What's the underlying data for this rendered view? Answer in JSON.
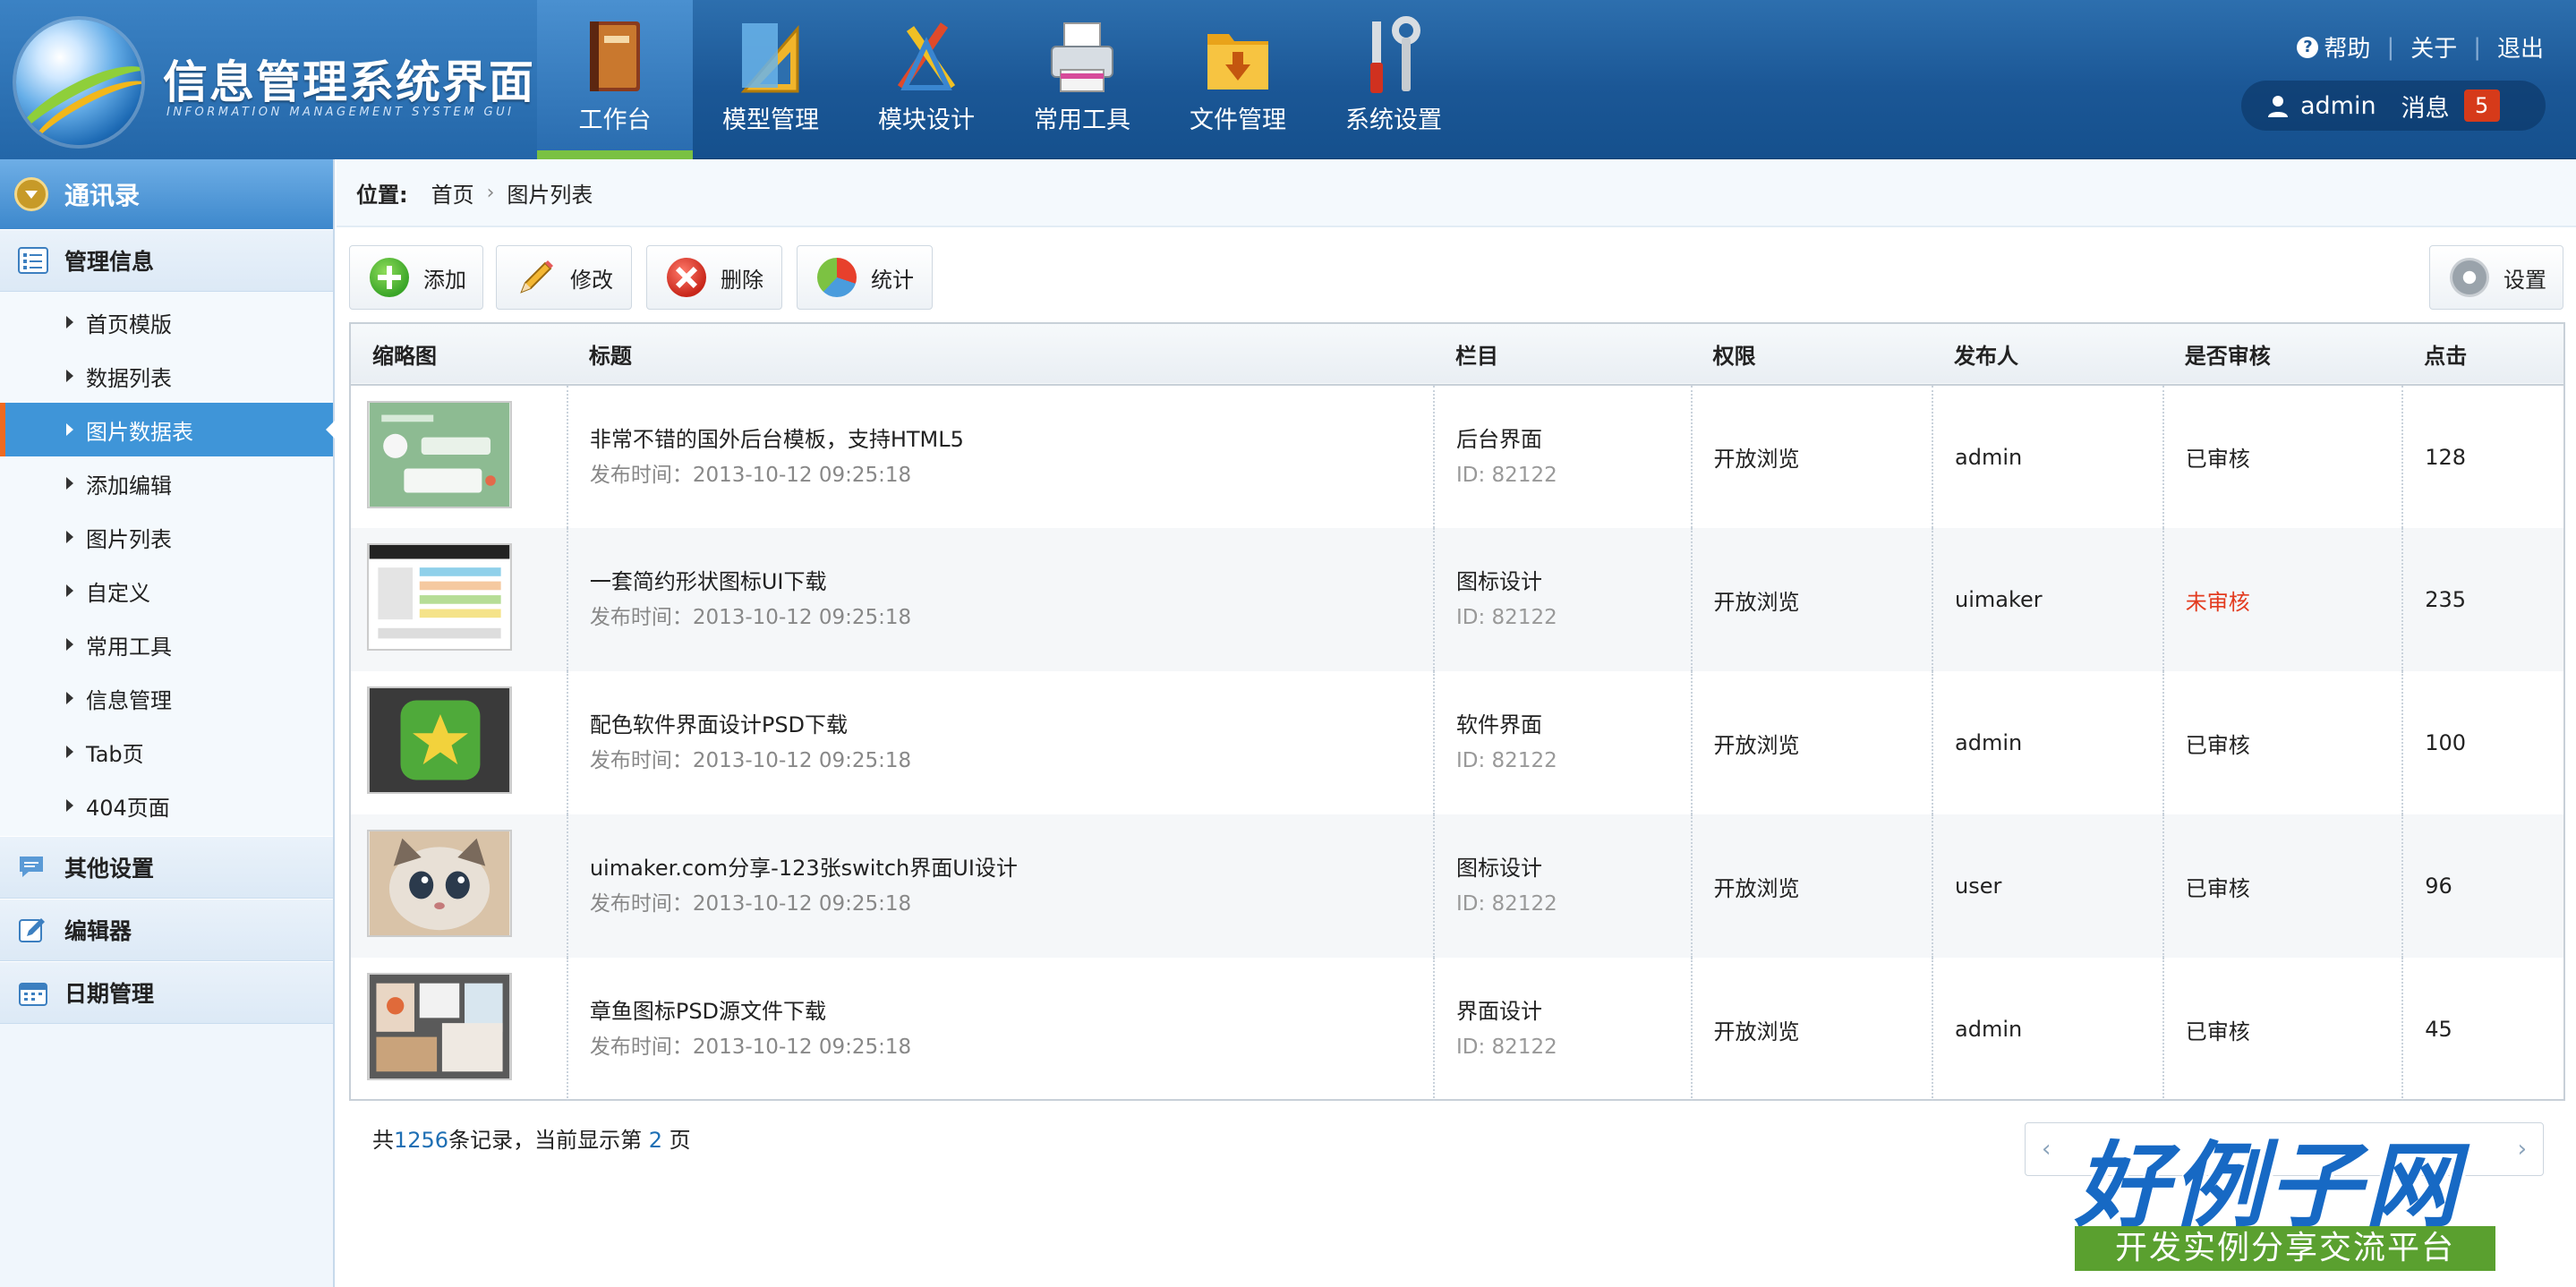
{
  "header": {
    "logo_title": "信息管理系统界面",
    "logo_subtitle": "INFORMATION MANAGEMENT SYSTEM GUI",
    "nav": [
      {
        "label": "工作台",
        "icon": "book-icon"
      },
      {
        "label": "模型管理",
        "icon": "ruler-triangle-icon"
      },
      {
        "label": "模块设计",
        "icon": "design-tools-icon"
      },
      {
        "label": "常用工具",
        "icon": "printer-icon"
      },
      {
        "label": "文件管理",
        "icon": "folder-icon"
      },
      {
        "label": "系统设置",
        "icon": "wrench-icon"
      }
    ],
    "links": {
      "help": "帮助",
      "about": "关于",
      "logout": "退出"
    },
    "user": "admin",
    "messages_label": "消息",
    "messages_count": "5"
  },
  "sidebar": {
    "top": "通讯录",
    "section_manage": "管理信息",
    "items": [
      "首页模版",
      "数据列表",
      "图片数据表",
      "添加编辑",
      "图片列表",
      "自定义",
      "常用工具",
      "信息管理",
      "Tab页",
      "404页面"
    ],
    "active_item": "图片数据表",
    "section_other": "其他设置",
    "section_editor": "编辑器",
    "section_date": "日期管理"
  },
  "breadcrumb": {
    "label": "位置:",
    "home": "首页",
    "current": "图片列表"
  },
  "toolbar": {
    "add": "添加",
    "edit": "修改",
    "delete": "删除",
    "stats": "统计",
    "settings": "设置"
  },
  "table": {
    "headers": [
      "缩略图",
      "标题",
      "栏目",
      "权限",
      "发布人",
      "是否审核",
      "点击"
    ],
    "rows": [
      {
        "title": "非常不错的国外后台模板，支持HTML5",
        "time": "发布时间：2013-10-12 09:25:18",
        "column": "后台界面",
        "id": "ID: 82122",
        "perm": "开放浏览",
        "author": "admin",
        "status": "已审核",
        "clicks": "128"
      },
      {
        "title": "一套简约形状图标UI下载",
        "time": "发布时间：2013-10-12 09:25:18",
        "column": "图标设计",
        "id": "ID: 82122",
        "perm": "开放浏览",
        "author": "uimaker",
        "status": "未审核",
        "clicks": "235"
      },
      {
        "title": "配色软件界面设计PSD下载",
        "time": "发布时间：2013-10-12 09:25:18",
        "column": "软件界面",
        "id": "ID: 82122",
        "perm": "开放浏览",
        "author": "admin",
        "status": "已审核",
        "clicks": "100"
      },
      {
        "title": "uimaker.com分享-123张switch界面UI设计",
        "time": "发布时间：2013-10-12 09:25:18",
        "column": "图标设计",
        "id": "ID: 82122",
        "perm": "开放浏览",
        "author": "user",
        "status": "已审核",
        "clicks": "96"
      },
      {
        "title": "章鱼图标PSD源文件下载",
        "time": "发布时间：2013-10-12 09:25:18",
        "column": "界面设计",
        "id": "ID: 82122",
        "perm": "开放浏览",
        "author": "admin",
        "status": "已审核",
        "clicks": "45"
      }
    ]
  },
  "footer": {
    "prefix": "共",
    "total": "1256",
    "middle": "条记录，当前显示第",
    "page": "2",
    "suffix": "页"
  },
  "pager": {
    "prev": "‹",
    "next": "›"
  },
  "watermark": {
    "big": "好例子网",
    "bar": "开发实例分享交流平台"
  },
  "colors": {
    "header": "#1b5796",
    "active_nav_underline": "#7ac143",
    "sidebar_active": "#3f95d8",
    "unreviewed": "#e33b1f"
  }
}
